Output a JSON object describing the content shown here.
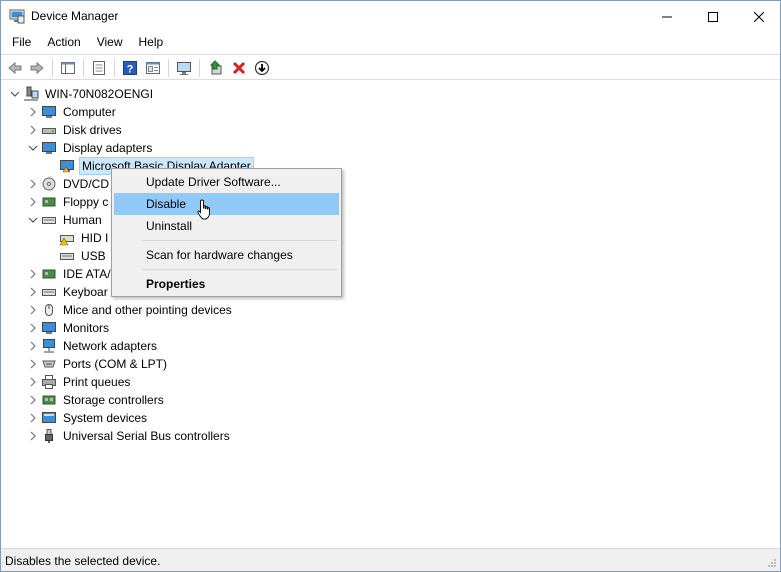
{
  "window": {
    "title": "Device Manager"
  },
  "menu": [
    "File",
    "Action",
    "View",
    "Help"
  ],
  "tree": {
    "root": "WIN-70N082OENGI",
    "items": [
      "Computer",
      "Disk drives",
      "Display adapters",
      "Microsoft Basic Display Adapter",
      "DVD/CD",
      "Floppy c",
      "Human",
      "HID I",
      "USB",
      "IDE ATA/",
      "Keyboar",
      "Mice and other pointing devices",
      "Monitors",
      "Network adapters",
      "Ports (COM & LPT)",
      "Print queues",
      "Storage controllers",
      "System devices",
      "Universal Serial Bus controllers"
    ]
  },
  "context_menu": {
    "update": "Update Driver Software...",
    "disable": "Disable",
    "uninstall": "Uninstall",
    "scan": "Scan for hardware changes",
    "properties": "Properties"
  },
  "status": {
    "text": "Disables the selected device."
  },
  "colors": {
    "selection": "#cce8ff",
    "menu_hover": "#91c9f7",
    "error_red": "#d9201f"
  }
}
